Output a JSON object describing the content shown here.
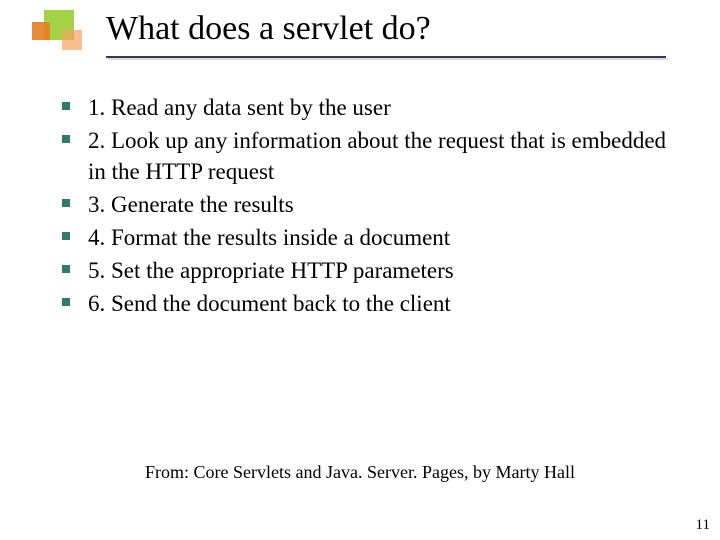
{
  "title": "What does a servlet do?",
  "bullets": [
    "1. Read any data sent by the user",
    "2. Look up any information about the request that is embedded in the HTTP request",
    "3. Generate the results",
    "4. Format the results inside a document",
    "5. Set the appropriate HTTP parameters",
    "6. Send the document back to the client"
  ],
  "citation": "From: Core Servlets and Java. Server. Pages, by Marty Hall",
  "page_number": "11"
}
